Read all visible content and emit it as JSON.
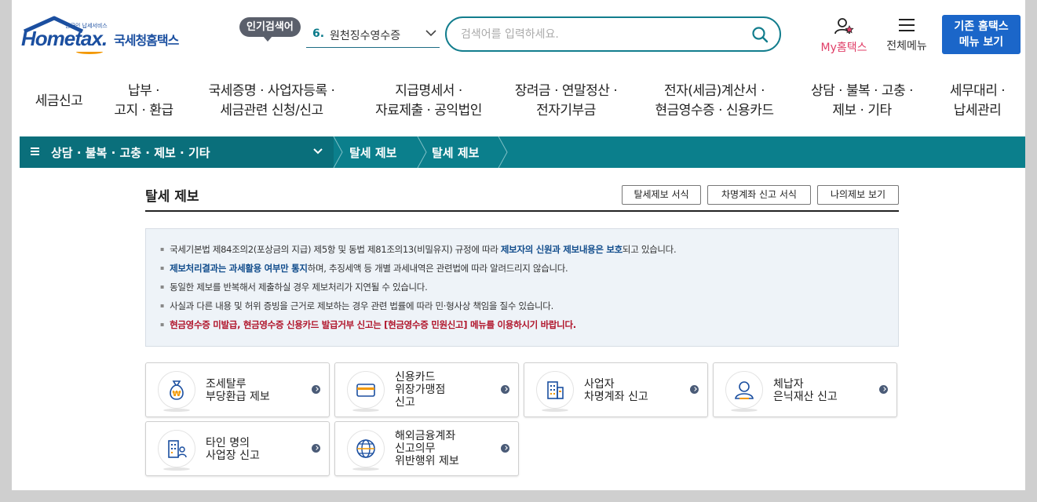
{
  "header": {
    "logo_small": "한국인 납세서비스",
    "logo_main_pre": "Hom",
    "logo_main_e": "e",
    "logo_main_post": "tax.",
    "logo_kr": "국세청홈택스",
    "popular_badge": "인기검색어",
    "popular_rank": "6.",
    "popular_term": "원천징수영수증",
    "search_placeholder": "검색어를 입력하세요.",
    "my_label": "My홈택스",
    "allmenu_label": "전체메뉴",
    "legacy_line1": "기존 홈택스",
    "legacy_line2": "메뉴 보기"
  },
  "gnb": [
    {
      "line1": "세금신고",
      "line2": ""
    },
    {
      "line1": "납부 ·",
      "line2": "고지 · 환급"
    },
    {
      "line1": "국세증명 · 사업자등록 ·",
      "line2": "세금관련 신청/신고"
    },
    {
      "line1": "지급명세서 ·",
      "line2": "자료제출 · 공익법인"
    },
    {
      "line1": "장려금 · 연말정산 ·",
      "line2": "전자기부금"
    },
    {
      "line1": "전자(세금)계산서 ·",
      "line2": "현금영수증 · 신용카드"
    },
    {
      "line1": "상담 · 불복 · 고충 ·",
      "line2": "제보 · 기타"
    },
    {
      "line1": "세무대리 ·",
      "line2": "납세관리"
    }
  ],
  "breadcrumb": {
    "menu_label": "상담 · 불복 · 고충 · 제보 · 기타",
    "item1": "탈세 제보",
    "item2": "탈세 제보"
  },
  "content": {
    "title": "탈세 제보",
    "buttons": [
      "탈세제보 서식",
      "차명계좌 신고 서식",
      "나의제보 보기"
    ],
    "notice": {
      "l1_pre": "국세기본법 제84조의2(포상금의 지급) 제5항 및 동법 제81조의13(비밀유지) 규정에 따라 ",
      "l1_hl": "제보자의 신원과 제보내용은 보호",
      "l1_post": "되고 있습니다.",
      "l2_hl": "제보처리결과는 과세활용 여부만 통지",
      "l2_post": "하며, 추징세액 등 개별 과세내역은 관련법에 따라 알려드리지 않습니다.",
      "l3": "동일한 제보를 반복해서 제출하실 경우 제보처리가 지연될 수 있습니다.",
      "l4": "사실과 다른 내용 및 허위 증빙을 근거로 제보하는 경우 관련 법률에 따라 민·형사상 책임을 질수 있습니다.",
      "l5": "현금영수증 미발급, 현금영수증 신용카드 발급거부 신고는 [현금영수증 민원신고] 메뉴를 이용하시기 바랍니다."
    },
    "cards": [
      {
        "lines": [
          "조세탈루",
          "부당환급 제보"
        ],
        "icon": "money-bag-icon"
      },
      {
        "lines": [
          "신용카드",
          "위장가맹점",
          "신고"
        ],
        "icon": "credit-card-icon"
      },
      {
        "lines": [
          "사업자",
          "차명계좌 신고"
        ],
        "icon": "building-icon"
      },
      {
        "lines": [
          "체납자",
          "은닉재산 신고"
        ],
        "icon": "person-icon"
      },
      {
        "lines": [
          "타인 명의",
          "사업장 신고"
        ],
        "icon": "building-person-icon"
      },
      {
        "lines": [
          "해외금융계좌",
          "신고의무",
          "위반행위 제보"
        ],
        "icon": "globe-icon"
      }
    ]
  },
  "colors": {
    "brand": "#1b4fa0",
    "teal": "#0b7f8c",
    "legacy_button": "#1b66c9",
    "my_pink": "#e03e67",
    "notice_red": "#b0142a"
  }
}
